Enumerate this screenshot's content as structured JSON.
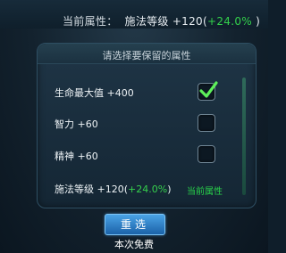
{
  "top": {
    "label": "当前属性：",
    "value": "施法等级 +120(",
    "pct": "+24.0%",
    "close": " )"
  },
  "dialog": {
    "title": "请选择要保留的属性",
    "rows": [
      {
        "label": "生命最大值 +400",
        "checked": true
      },
      {
        "label": "智力 +60",
        "checked": false
      },
      {
        "label": "精神 +60",
        "checked": false
      }
    ],
    "current_row": {
      "prefix": "施法等级 +120(",
      "pct": "+24.0%",
      "suffix": ")",
      "tag": "当前属性"
    }
  },
  "button": {
    "label": "重选"
  },
  "footer": {
    "free": "本次免费"
  },
  "colors": {
    "accent_green": "#33d04b",
    "button_blue": "#2e86d0"
  }
}
